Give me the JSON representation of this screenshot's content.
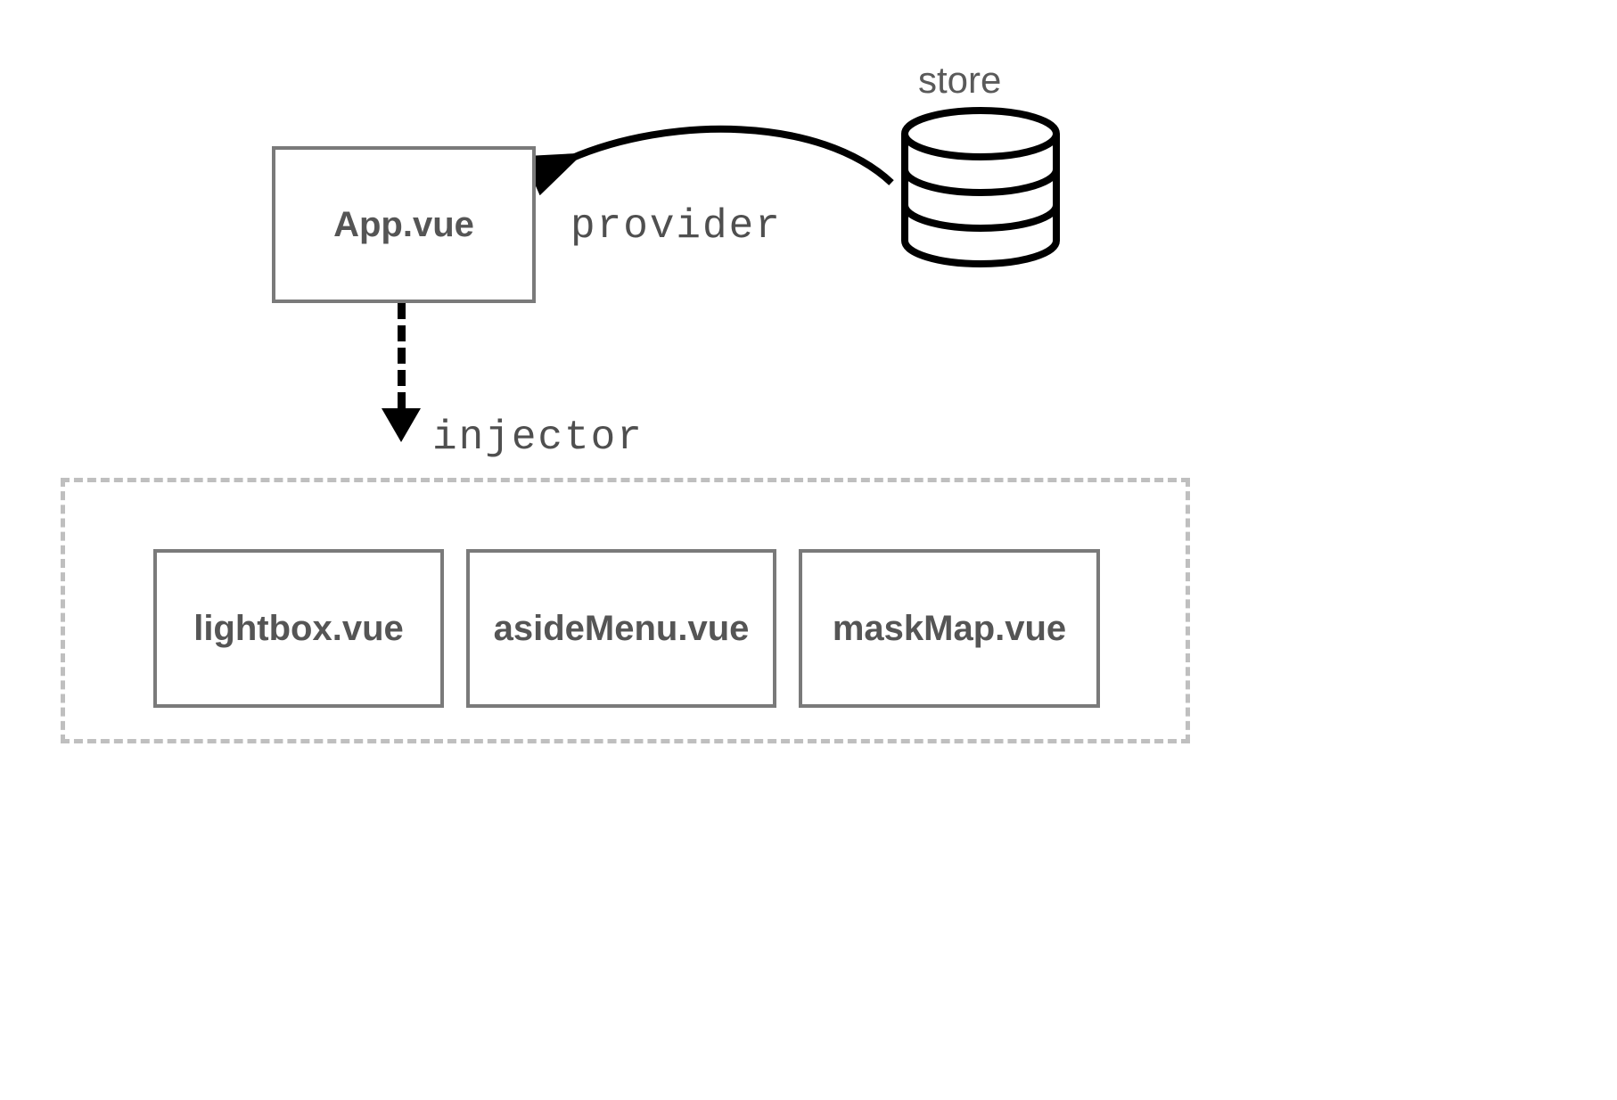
{
  "nodes": {
    "app": "App.vue",
    "lightbox": "lightbox.vue",
    "asideMenu": "asideMenu.vue",
    "maskMap": "maskMap.vue"
  },
  "labels": {
    "store": "store",
    "provider": "provider",
    "injector": "injector"
  }
}
